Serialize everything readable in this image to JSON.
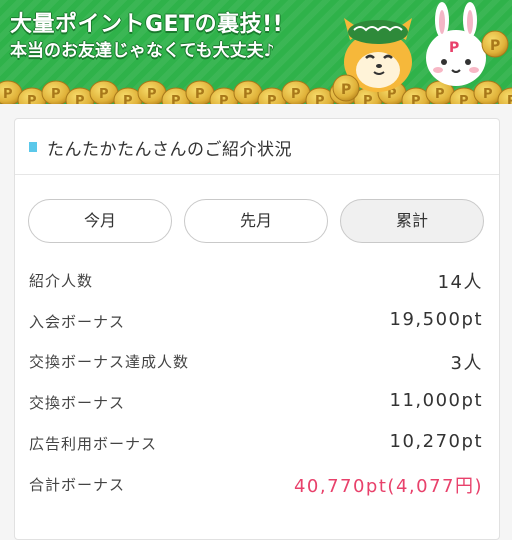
{
  "banner": {
    "line1": "大量ポイントGETの裏技!!",
    "line2": "本当のお友達じゃなくても大丈夫♪",
    "coin_letter": "P",
    "coin_color": "#e0b23a",
    "background_color": "#2fb24a"
  },
  "card": {
    "title": "たんたかたんさんのご紹介状況",
    "tabs": [
      {
        "label": "今月",
        "active": false
      },
      {
        "label": "先月",
        "active": false
      },
      {
        "label": "累計",
        "active": true
      }
    ],
    "rows": [
      {
        "label": "紹介人数",
        "value": "14人"
      },
      {
        "label": "入会ボーナス",
        "value": "19,500pt"
      },
      {
        "label": "交換ボーナス達成人数",
        "value": "3人"
      },
      {
        "label": "交換ボーナス",
        "value": "11,000pt"
      },
      {
        "label": "広告利用ボーナス",
        "value": "10,270pt"
      },
      {
        "label": "合計ボーナス",
        "value": "40,770pt(4,077円)"
      }
    ],
    "accent_color": "#5bc8ea",
    "total_color": "#e8416b"
  }
}
